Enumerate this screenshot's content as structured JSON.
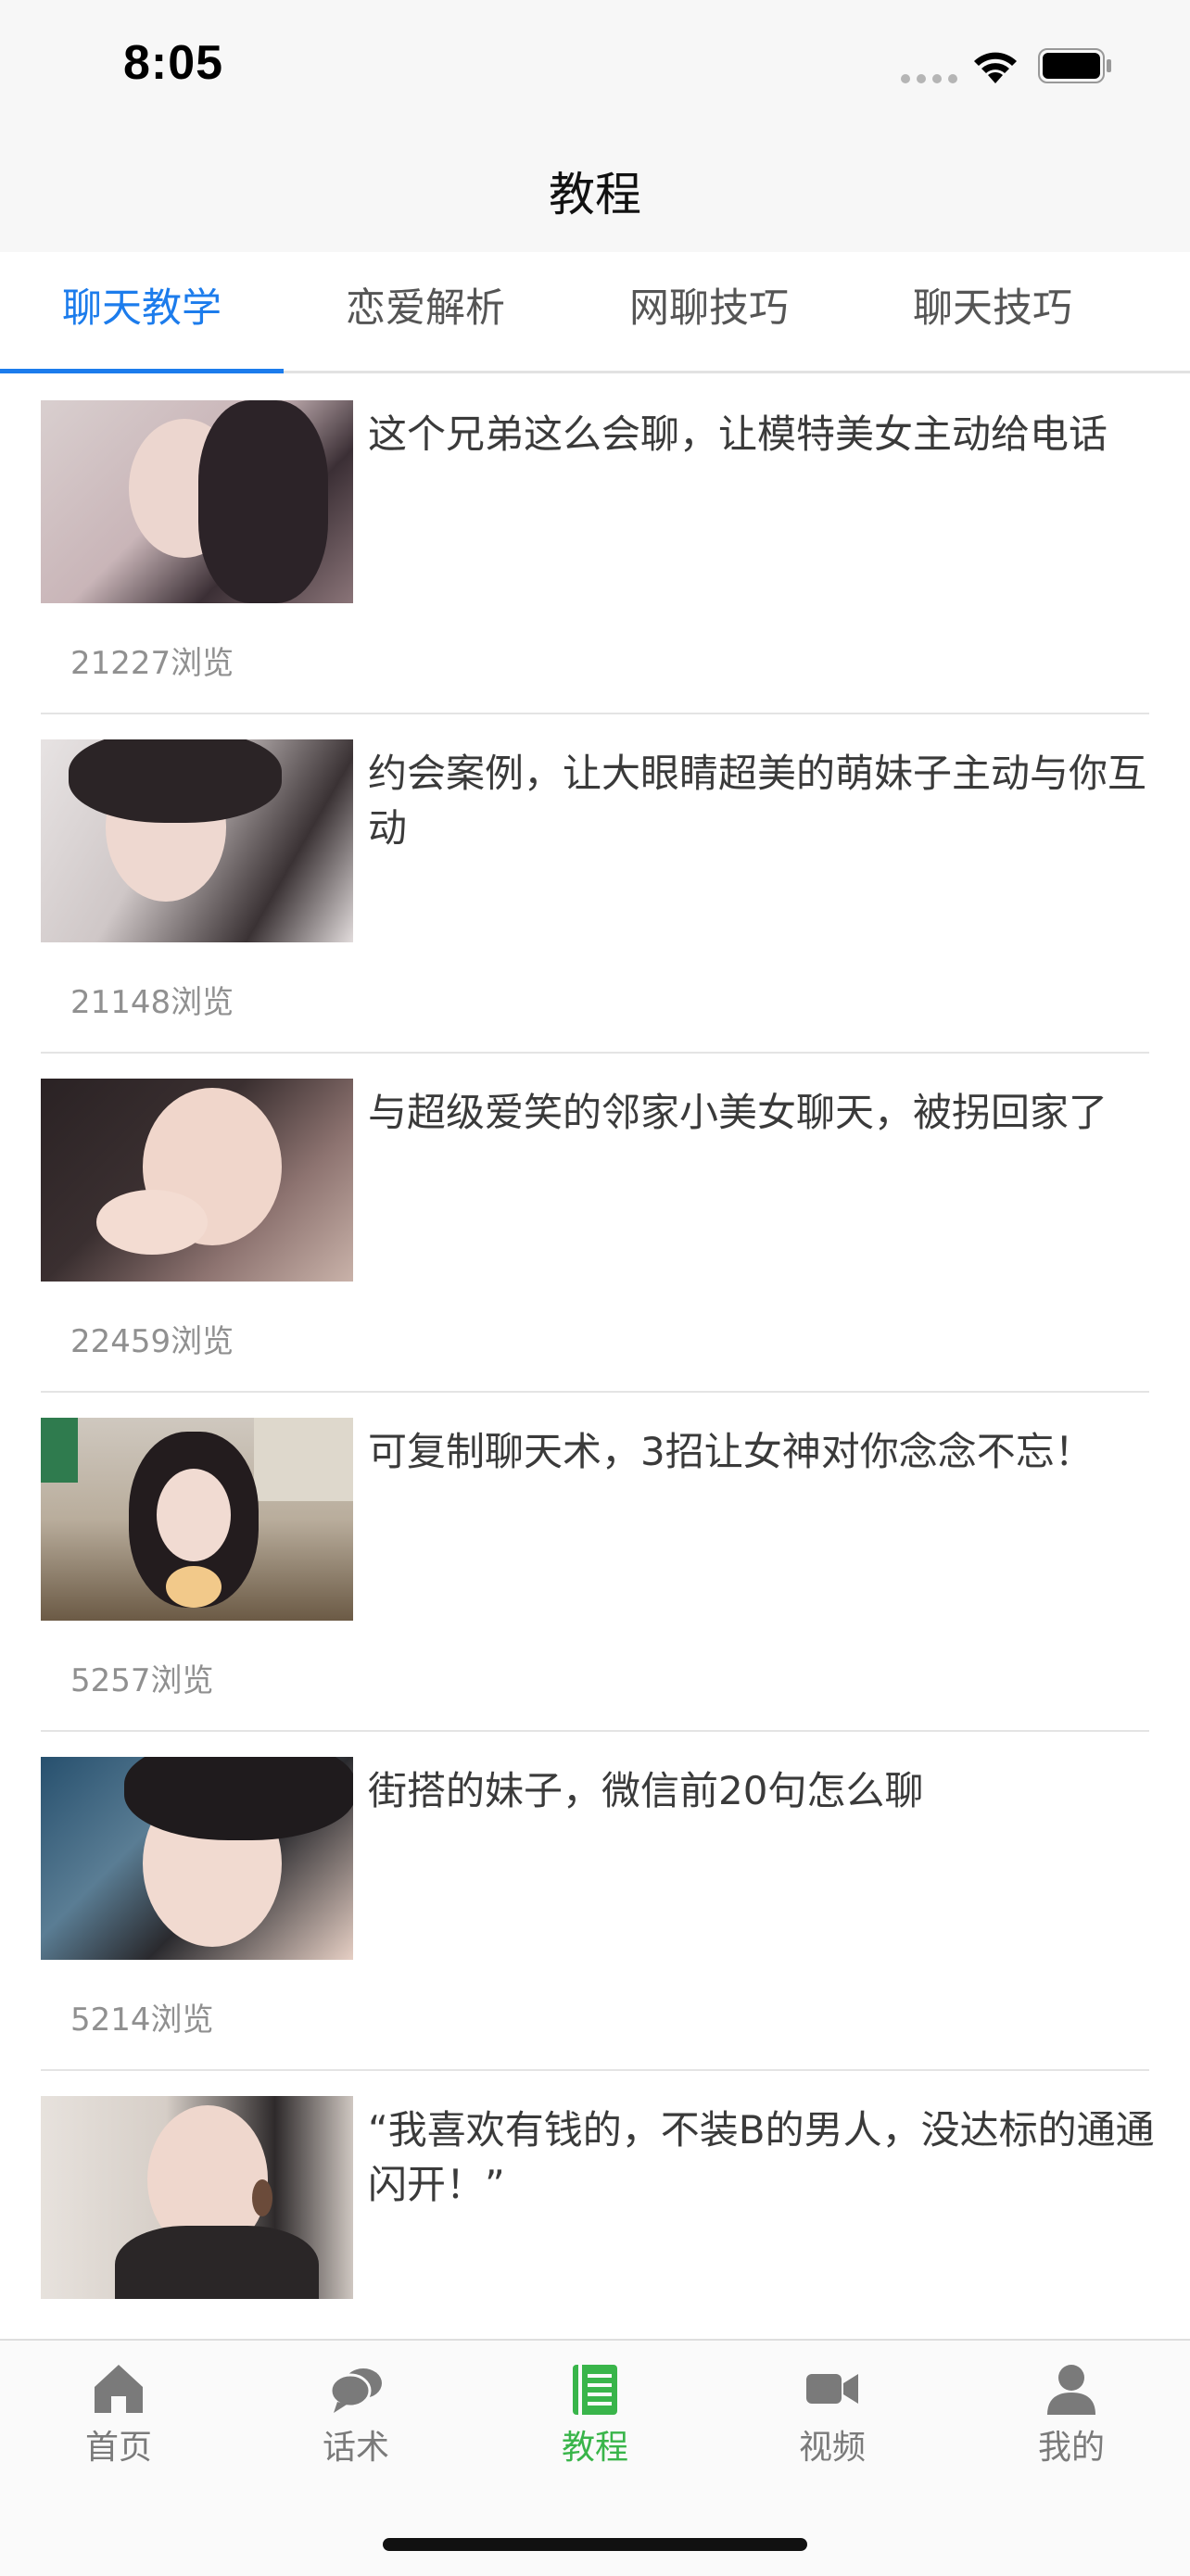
{
  "status_bar": {
    "time": "8:05"
  },
  "nav": {
    "title": "教程"
  },
  "tabs": [
    "聊天教学",
    "恋爱解析",
    "网聊技巧",
    "聊天技巧"
  ],
  "active_tab": 0,
  "articles": [
    {
      "title": "这个兄弟这么会聊，让模特美女主动给电话",
      "views": "21227浏览"
    },
    {
      "title": "约会案例，让大眼睛超美的萌妹子主动与你互动",
      "views": "21148浏览"
    },
    {
      "title": "与超级爱笑的邻家小美女聊天，被拐回家了",
      "views": "22459浏览"
    },
    {
      "title": "可复制聊天术，3招让女神对你念念不忘！",
      "views": "5257浏览"
    },
    {
      "title": "街搭的妹子，微信前20句怎么聊",
      "views": "5214浏览"
    },
    {
      "title": "“我喜欢有钱的，不装B的男人，没达标的通通闪开！”",
      "views": ""
    }
  ],
  "tabbar": [
    {
      "label": "首页",
      "icon": "home-icon"
    },
    {
      "label": "话术",
      "icon": "chat-bubbles-icon"
    },
    {
      "label": "教程",
      "icon": "book-list-icon"
    },
    {
      "label": "视频",
      "icon": "video-camera-icon"
    },
    {
      "label": "我的",
      "icon": "user-icon"
    }
  ],
  "colors": {
    "accent_blue": "#1c7cec",
    "active_green": "#39b54a",
    "inactive_gray": "#7a7a7a"
  }
}
